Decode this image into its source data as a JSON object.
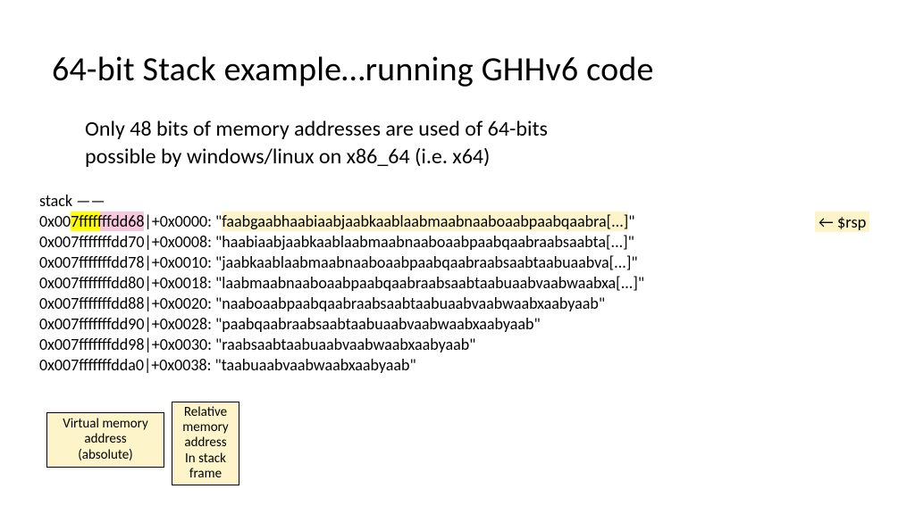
{
  "title": "64-bit Stack example…running GHHv6 code",
  "subtitle_line1": "Only 48 bits of memory addresses are used of 64-bits",
  "subtitle_line2": "possible by windows/linux on x86_64 (i.e. x64)",
  "stack_header": "stack ——",
  "rows": [
    {
      "pre": "0x00",
      "hl48": "7fffffffdd68",
      "sep": "|",
      "off": "+0x0000: ",
      "q": "\"",
      "val": "faabgaabhaabiaabjaabkaablaabmaabnaaboaabpaabqaabra[...]",
      "q2": "\"",
      "rsp": true
    },
    {
      "addr": "0x007fffffffdd70",
      "sep": "|",
      "off": "+0x0008: ",
      "val": "\"haabiaabjaabkaablaabmaabnaaboaabpaabqaabraabsaabta[...]\""
    },
    {
      "addr": "0x007fffffffdd78",
      "sep": "|",
      "off": "+0x0010: ",
      "val": "\"jaabkaablaabmaabnaaboaabpaabqaabraabsaabtaabuaabva[...]\""
    },
    {
      "addr": "0x007fffffffdd80",
      "sep": "|",
      "off": "+0x0018: ",
      "val": "\"laabmaabnaaboaabpaabqaabraabsaabtaabuaabvaabwaabxa[...]\""
    },
    {
      "addr": "0x007fffffffdd88",
      "sep": "|",
      "off": "+0x0020: ",
      "val": "\"naaboaabpaabqaabraabsaabtaabuaabvaabwaabxaabyaab\""
    },
    {
      "addr": "0x007fffffffdd90",
      "sep": "|",
      "off": "+0x0028: ",
      "val": "\"paabqaabraabsaabtaabuaabvaabwaabxaabyaab\""
    },
    {
      "addr": "0x007fffffffdd98",
      "sep": "|",
      "off": "+0x0030: ",
      "val": "\"raabsaabtaabuaabvaabwaabxaabyaab\""
    },
    {
      "addr": "0x007fffffffdda0",
      "sep": "|",
      "off": "+0x0038: ",
      "val": "\"taabuaabvaabwaabxaabyaab\""
    }
  ],
  "rsp_text": "← $rsp",
  "callout1_l1": "Virtual memory",
  "callout1_l2": "address",
  "callout1_l3": "(absolute)",
  "callout2_l1": "Relative",
  "callout2_l2": "memory",
  "callout2_l3": "address",
  "callout2_l4": "In stack",
  "callout2_l5": "frame"
}
